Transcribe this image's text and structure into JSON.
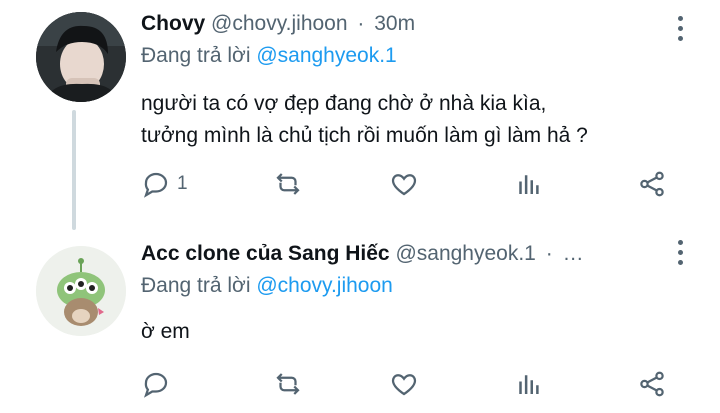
{
  "tweets": [
    {
      "name": "Chovy",
      "handle": "@chovy.jihoon",
      "dot": "·",
      "time": "30m",
      "replying_prefix": "Đang trả lời",
      "replying_to": "@sanghyeok.1",
      "text_line1": "người ta có vợ đẹp đang chờ ở nhà kia kìa,",
      "text_line2": "tưởng mình là chủ tịch rồi muốn làm gì làm hả ?",
      "reply_count": "1"
    },
    {
      "name": "Acc clone của Sang Hiếc",
      "handle": "@sanghyeok.1",
      "dot": "·",
      "time": "…",
      "replying_prefix": "Đang trả lời",
      "replying_to": "@chovy.jihoon",
      "text_line1": "ờ em",
      "reply_count": ""
    }
  ],
  "icons": {
    "reply": "reply-icon",
    "retweet": "retweet-icon",
    "like": "heart-icon",
    "analytics": "analytics-icon",
    "share": "share-icon",
    "more": "more-options-icon"
  },
  "colors": {
    "accent": "#1d9bf0",
    "secondary_text": "#536471",
    "thread_line": "#cfd9de"
  }
}
